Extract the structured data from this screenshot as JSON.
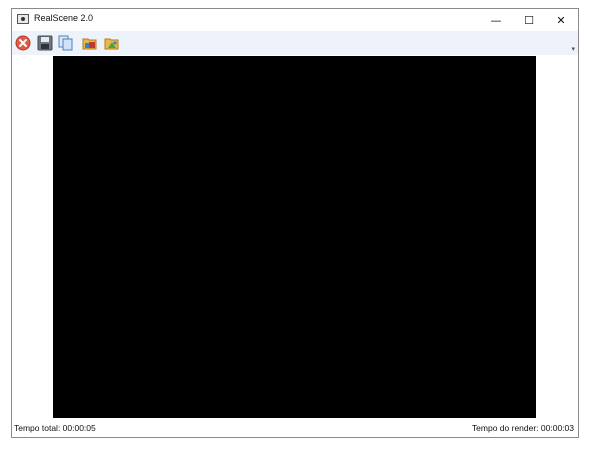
{
  "window": {
    "title": "RealScene 2.0",
    "controls": {
      "minimize": "—",
      "maximize": "☐",
      "close": "✕"
    }
  },
  "toolbar": {
    "items": [
      {
        "icon": "close-red-circle-icon"
      },
      {
        "icon": "save-floppy-icon"
      },
      {
        "icon": "copy-icon"
      },
      {
        "icon": "folder-open-icon"
      },
      {
        "icon": "folder-image-icon"
      }
    ],
    "overflow_glyph": "▾"
  },
  "render": {
    "background": "#000000"
  },
  "status": {
    "total_time": "Tempo total: 00:00:05",
    "render_time": "Tempo do render: 00:00:03"
  }
}
